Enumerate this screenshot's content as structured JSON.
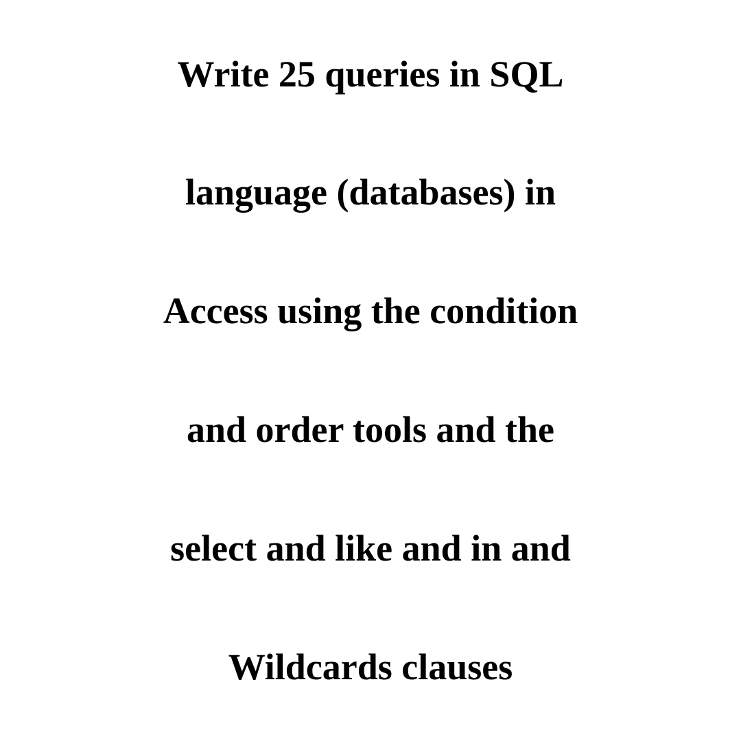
{
  "text": {
    "line1": "Write 25 queries in SQL",
    "line2": "language (databases) in",
    "line3": "Access using the condition",
    "line4": "and order tools and the",
    "line5": "select and like and in and",
    "line6": "Wildcards clauses"
  }
}
